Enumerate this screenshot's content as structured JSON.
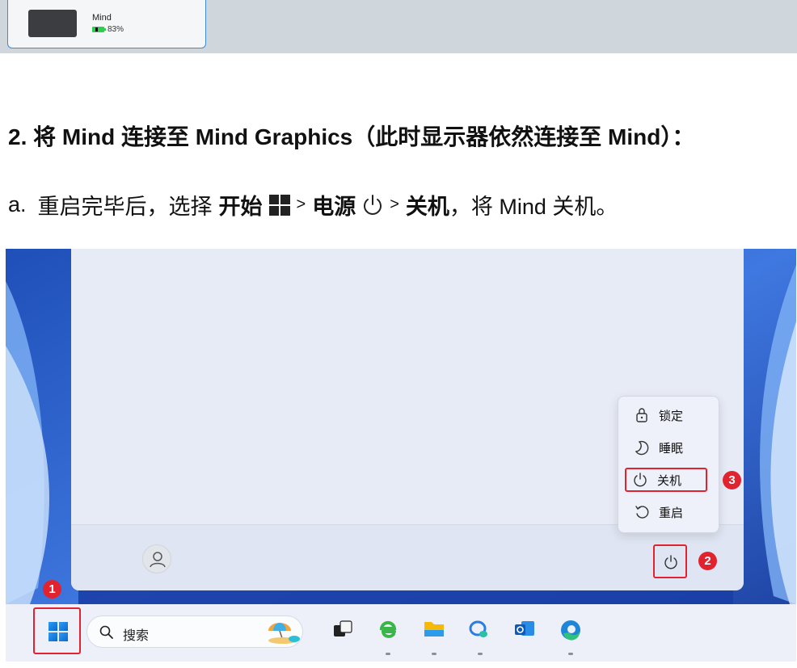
{
  "device": {
    "name": "Mind",
    "battery": "83%",
    "battery_level": 0.83
  },
  "heading": {
    "number": "2.",
    "text": "将 Mind 连接至 Mind Graphics（此时显示器依然连接至 Mind）："
  },
  "step": {
    "letter": "a.",
    "prefix": "重启完毕后，选择",
    "start": "开始",
    "sep1": ">",
    "power": "电源",
    "sep2": ">",
    "shutdown": "关机",
    "suffix": "，将 Mind 关机。"
  },
  "power_menu": {
    "items": [
      {
        "label": "锁定",
        "icon": "lock-icon"
      },
      {
        "label": "睡眠",
        "icon": "moon-icon"
      },
      {
        "label": "关机",
        "icon": "power-icon"
      },
      {
        "label": "重启",
        "icon": "restart-icon"
      }
    ]
  },
  "taskbar": {
    "search_placeholder": "搜索",
    "apps": [
      "task-view-icon",
      "ie-icon",
      "file-explorer-icon",
      "chat-icon",
      "outlook-icon",
      "edge-icon"
    ]
  },
  "callouts": [
    "1",
    "2",
    "3"
  ],
  "colors": {
    "callout_red": "#e0232e",
    "accent_blue": "#3d8bd9",
    "battery_green": "#2bd14c"
  }
}
